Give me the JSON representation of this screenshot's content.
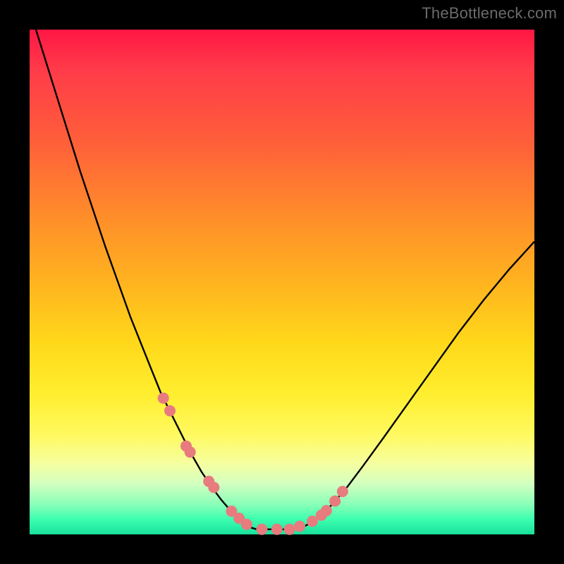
{
  "watermark": "TheBottleneck.com",
  "colors": {
    "frame": "#000000",
    "line": "#000000",
    "dot": "#e77b7e",
    "top": "#ff1744",
    "mid": "#ffd81a",
    "bottom": "#18e09c"
  },
  "chart_data": {
    "type": "line",
    "title": "",
    "xlabel": "",
    "ylabel": "",
    "xlim": [
      0,
      100
    ],
    "ylim": [
      0,
      100
    ],
    "grid": false,
    "legend": false,
    "annotations": [],
    "series": [
      {
        "name": "curve",
        "x": [
          0,
          5,
          10,
          15,
          20,
          22,
          24,
          26,
          28,
          30,
          32,
          34,
          36,
          38,
          40,
          42,
          43,
          44,
          45,
          48,
          50,
          52,
          54,
          56,
          58,
          60,
          63,
          66,
          70,
          75,
          80,
          85,
          90,
          95,
          100
        ],
        "y": [
          104,
          88,
          72,
          57,
          43,
          38,
          33,
          28,
          24,
          20,
          16,
          12.5,
          9.5,
          6.8,
          4.5,
          2.6,
          1.8,
          1.3,
          1.0,
          1.0,
          1.0,
          1.0,
          1.4,
          2.4,
          4.0,
          6.0,
          9.5,
          13.5,
          19,
          26,
          33,
          40,
          46.5,
          52.5,
          58
        ]
      }
    ],
    "dots": {
      "name": "markers",
      "x": [
        26.5,
        27.8,
        31.0,
        31.8,
        35.5,
        36.5,
        40.0,
        41.5,
        43.0,
        46.0,
        49.0,
        51.5,
        53.5,
        56.0,
        57.8,
        58.8,
        60.5,
        62.0
      ],
      "y": [
        27.0,
        24.5,
        17.5,
        16.3,
        10.5,
        9.3,
        4.6,
        3.2,
        2.0,
        1.0,
        1.0,
        1.0,
        1.6,
        2.6,
        3.8,
        4.7,
        6.6,
        8.5
      ]
    }
  }
}
